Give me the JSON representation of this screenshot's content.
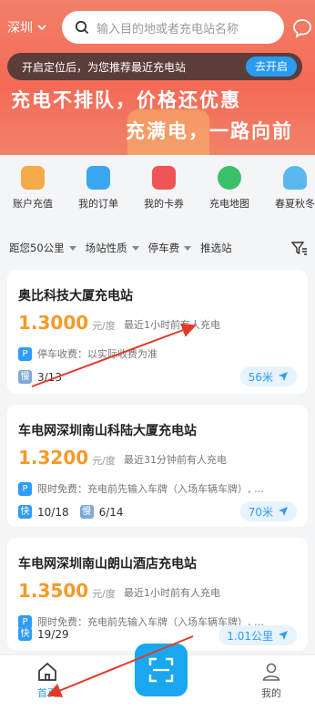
{
  "header": {
    "city": "深圳",
    "search_placeholder": "输入目的地或者充电站名称"
  },
  "toast": {
    "text": "开启定位后，为您推荐最近充电站",
    "button": "去开启"
  },
  "banner": {
    "line1": "充电不排队，价格还优惠",
    "line2": "充满电，一路向前"
  },
  "menu": [
    {
      "label": "账户充值",
      "icon": "wallet-icon",
      "color": "#f6a94a"
    },
    {
      "label": "我的订单",
      "icon": "order-icon",
      "color": "#3aa6f3"
    },
    {
      "label": "我的卡券",
      "icon": "coupon-icon",
      "color": "#f05454"
    },
    {
      "label": "充电地图",
      "icon": "map-icon",
      "color": "#3cc16b"
    },
    {
      "label": "春夏秋冬",
      "icon": "weather-icon",
      "color": "#5bb8ef"
    }
  ],
  "filters": [
    "距您50公里",
    "场站性质",
    "停车费",
    "推选站"
  ],
  "stations": [
    {
      "name": "奥比科技大厦充电站",
      "price": "1.3000",
      "unit": "元/度",
      "recent": "最近1小时前有人充电",
      "parking": "停车收费：以实际收费为准",
      "slow": "3/13",
      "fast": "",
      "distance": "56米"
    },
    {
      "name": "车电网深圳南山科陆大厦充电站",
      "price": "1.3200",
      "unit": "元/度",
      "recent": "最近31分钟前有人充电",
      "parking": "限时免费：充电前先输入车牌（入场车辆车牌）, …",
      "fast": "10/18",
      "slow": "6/14",
      "distance": "70米"
    },
    {
      "name": "车电网深圳南山朗山酒店充电站",
      "price": "1.3500",
      "unit": "元/度",
      "recent": "最近1小时前有人充电",
      "parking": "限时免费：充电前先输入车牌（入场车辆车牌）, …",
      "fast": "19/29",
      "slow": "",
      "distance": "1.01公里"
    }
  ],
  "labels": {
    "parking_badge": "P",
    "fast_badge": "快",
    "slow_badge": "慢"
  },
  "tabbar": {
    "home": "首页",
    "mine": "我的",
    "scan_icon": "scan-icon"
  },
  "colors": {
    "accent": "#2f9cf5",
    "price": "#f59a28",
    "banner": "#f46a57"
  }
}
